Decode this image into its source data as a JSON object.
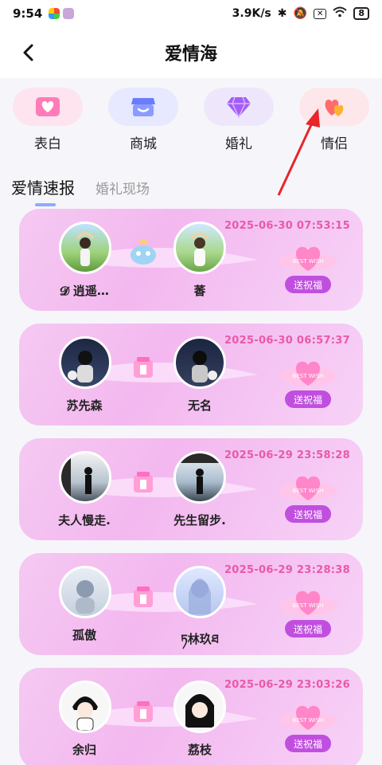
{
  "status": {
    "time": "9:54",
    "speed": "3.9K/s",
    "battery": "8"
  },
  "header": {
    "title": "爱情海"
  },
  "categories": [
    {
      "label": "表白",
      "icon": "love-letter-icon",
      "bg": "#fde4ef",
      "color": "#ff5aa5"
    },
    {
      "label": "商城",
      "icon": "store-icon",
      "bg": "#e6e9ff",
      "color": "#6a7dff"
    },
    {
      "label": "婚礼",
      "icon": "diamond-icon",
      "bg": "#eee7fb",
      "color": "#a35cf5"
    },
    {
      "label": "情侣",
      "icon": "couple-heart-icon",
      "bg": "#fde7ea",
      "color": "#ff6b6b"
    }
  ],
  "tabs": {
    "active": "爱情速报",
    "other": "婚礼现场"
  },
  "feed": [
    {
      "left_name": "𝓓 逍遥…",
      "right_name": "萫",
      "time": "2025-06-30 07:53:15",
      "button": "送祝福"
    },
    {
      "left_name": "苏先森",
      "right_name": "无名",
      "time": "2025-06-30 06:57:37",
      "button": "送祝福"
    },
    {
      "left_name": "夫人慢走.",
      "right_name": "先生留步.",
      "time": "2025-06-29 23:58:28",
      "button": "送祝福"
    },
    {
      "left_name": "孤傲",
      "right_name": "ཏ林玖ཐ",
      "time": "2025-06-29 23:28:38",
      "button": "送祝福"
    },
    {
      "left_name": "余归",
      "right_name": "荔枝",
      "time": "2025-06-29 23:03:26",
      "button": "送祝福"
    }
  ],
  "colors": {
    "accent": "#e85aa6",
    "button": "#c04fdf",
    "arrow": "#e8252a"
  }
}
